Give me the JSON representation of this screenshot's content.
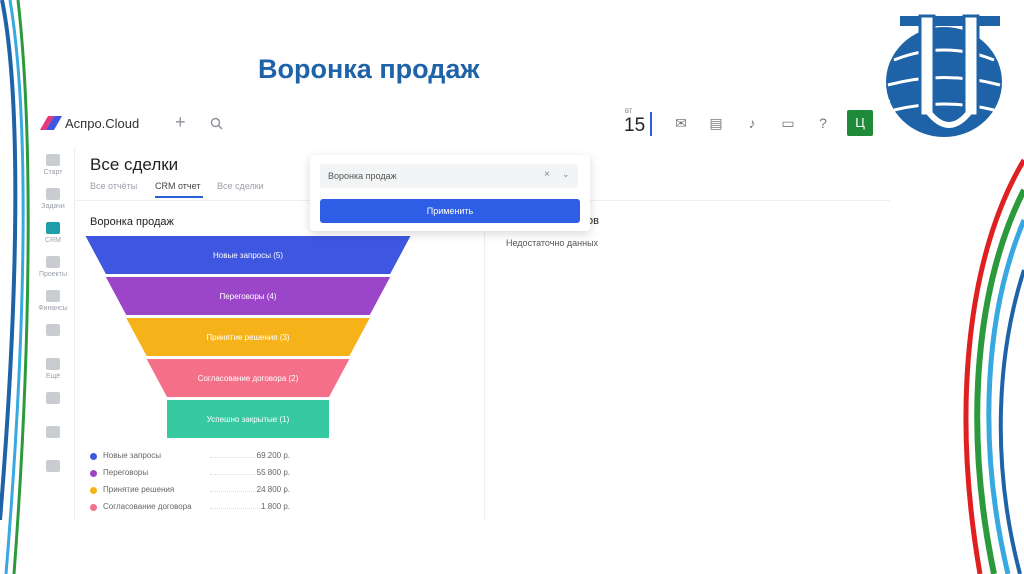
{
  "slide": {
    "title": "Воронка продаж"
  },
  "app": {
    "brand": "Аспро.Cloud",
    "date_small": "ВТ",
    "date_big": "15",
    "avatar_letter": "Ц"
  },
  "sidebar": {
    "items": [
      {
        "label": "Старт",
        "icon": "start-icon"
      },
      {
        "label": "Задачи",
        "icon": "tasks-icon"
      },
      {
        "label": "CRM",
        "icon": "funnel-icon",
        "active": true
      },
      {
        "label": "Проекты",
        "icon": "projects-icon"
      },
      {
        "label": "Финансы",
        "icon": "finance-icon"
      },
      {
        "label": "",
        "icon": "people-icon"
      },
      {
        "label": "Ещё",
        "icon": "grid-icon"
      },
      {
        "label": "",
        "icon": "app-icon"
      },
      {
        "label": "",
        "icon": "tag-icon"
      },
      {
        "label": "",
        "icon": "chat-icon"
      }
    ]
  },
  "page": {
    "heading": "Все сделки",
    "tabs": [
      {
        "label": "Все отчёты"
      },
      {
        "label": "CRM отчет",
        "active": true
      },
      {
        "label": "Все сделки"
      }
    ],
    "funnel_heading": "Воронка продаж",
    "right_heading_fragment": "ов",
    "no_data": "Недостаточно данных"
  },
  "popup": {
    "select_value": "Воронка продаж",
    "clear": "×",
    "apply": "Применить"
  },
  "funnel": {
    "stages": [
      {
        "label": "Новые запросы (5)",
        "color": "#3f57e0"
      },
      {
        "label": "Переговоры (4)",
        "color": "#9b46c8"
      },
      {
        "label": "Принятие решения (3)",
        "color": "#f6b319"
      },
      {
        "label": "Согласование договора (2)",
        "color": "#f47089"
      },
      {
        "label": "Успешно закрытые (1)",
        "color": "#36c9a2"
      }
    ]
  },
  "legend": [
    {
      "name": "Новые запросы",
      "value": "69 200 р.",
      "color": "#3f57e0"
    },
    {
      "name": "Переговоры",
      "value": "55 800 р.",
      "color": "#9b46c8"
    },
    {
      "name": "Принятие решения",
      "value": "24 800 р.",
      "color": "#f6b319"
    },
    {
      "name": "Согласование договора",
      "value": "1 800 р.",
      "color": "#f47089"
    }
  ]
}
